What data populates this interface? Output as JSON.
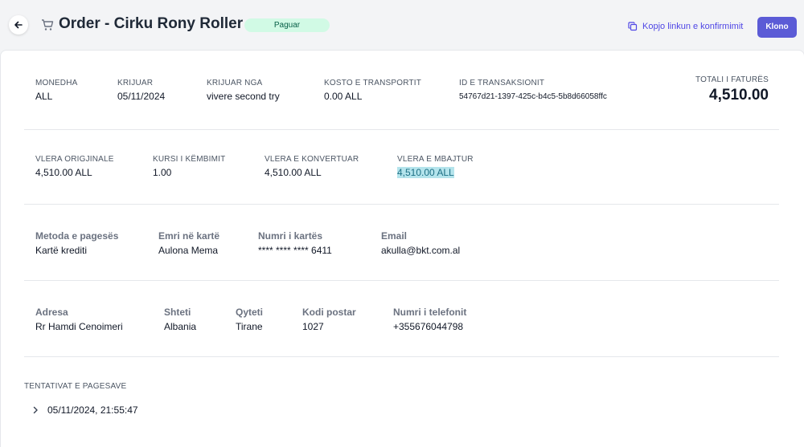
{
  "header": {
    "title": "Order - Cirku Rony Roller",
    "status": "Paguar",
    "copy_link_label": "Kopjo linkun e konfirmimit",
    "clone_label": "Klono"
  },
  "summary": {
    "currency_label": "MONEDHA",
    "currency_value": "ALL",
    "created_label": "KRIJUAR",
    "created_value": "05/11/2024",
    "created_by_label": "KRIJUAR NGA",
    "created_by_value": "vivere second try",
    "shipping_label": "KOSTO E TRANSPORTIT",
    "shipping_value": "0.00 ALL",
    "transaction_label": "ID E TRANSAKSIONIT",
    "transaction_value": "54767d21-1397-425c-b4c5-5b8d66058ffc",
    "total_label": "TOTALI I FATURËS",
    "total_value": "4,510.00"
  },
  "amounts": {
    "original_label": "VLERA ORIGJINALE",
    "original_value": "4,510.00 ALL",
    "rate_label": "KURSI I KËMBIMIT",
    "rate_value": "1.00",
    "converted_label": "VLERA E KONVERTUAR",
    "converted_value": "4,510.00 ALL",
    "held_label": "VLERA E MBAJTUR",
    "held_value": "4,510.00 ALL"
  },
  "payment": {
    "method_label": "Metoda e pagesës",
    "method_value": "Kartë krediti",
    "name_label": "Emri në kartë",
    "name_value": "Aulona Mema",
    "card_label": "Numri i kartës",
    "card_value": "**** **** **** 6411",
    "email_label": "Email",
    "email_value": "akulla@bkt.com.al"
  },
  "address": {
    "street_label": "Adresa",
    "street_value": "Rr Hamdi Cenoimeri",
    "country_label": "Shteti",
    "country_value": "Albania",
    "city_label": "Qyteti",
    "city_value": "Tirane",
    "zip_label": "Kodi postar",
    "zip_value": "1027",
    "phone_label": "Numri i telefonit",
    "phone_value": "+355676044798"
  },
  "attempts": {
    "title": "TENTATIVAT E PAGESAVE",
    "items": [
      {
        "timestamp": "05/11/2024, 21:55:47"
      }
    ]
  }
}
